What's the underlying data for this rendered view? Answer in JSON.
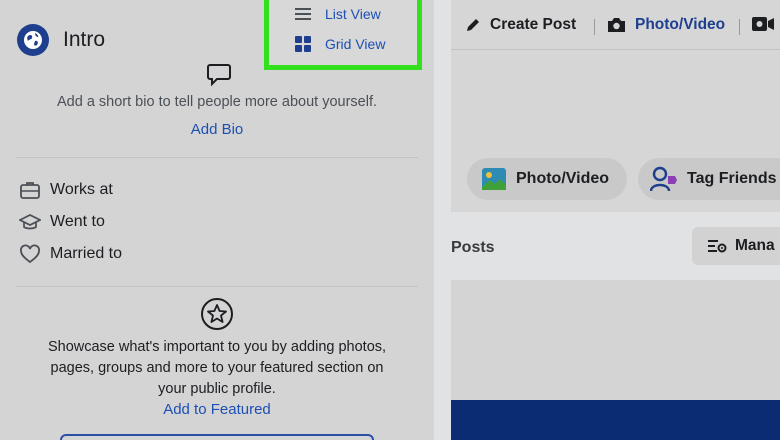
{
  "intro": {
    "title": "Intro",
    "bio_prompt": "Add a short bio to tell people more about yourself.",
    "add_bio": "Add Bio",
    "details": [
      {
        "label": "Works at",
        "icon": "briefcase-icon"
      },
      {
        "label": "Went to",
        "icon": "graduation-cap-icon"
      },
      {
        "label": "Married to",
        "icon": "heart-icon"
      }
    ],
    "showcase_lines": [
      "Showcase what's important to you by adding photos,",
      "pages, groups and more to your featured section on",
      "your public profile."
    ],
    "add_featured": "Add to Featured"
  },
  "view_menu": {
    "highlight_color": "#33e01c",
    "items": [
      {
        "label": "List View",
        "icon": "list-icon"
      },
      {
        "label": "Grid View",
        "icon": "grid-icon"
      }
    ]
  },
  "composer": {
    "tabs": [
      {
        "label": "Create Post",
        "icon": "pencil-icon"
      },
      {
        "label": "Photo/Video",
        "icon": "camera-icon"
      }
    ],
    "pills": [
      {
        "label": "Photo/Video",
        "icon": "photo-icon"
      },
      {
        "label": "Tag Friends",
        "icon": "tag-friends-icon"
      }
    ]
  },
  "posts": {
    "label": "Posts",
    "manage_label": "Mana"
  },
  "colors": {
    "link": "#1d4fb5",
    "brand_dark": "#0b2b73"
  }
}
